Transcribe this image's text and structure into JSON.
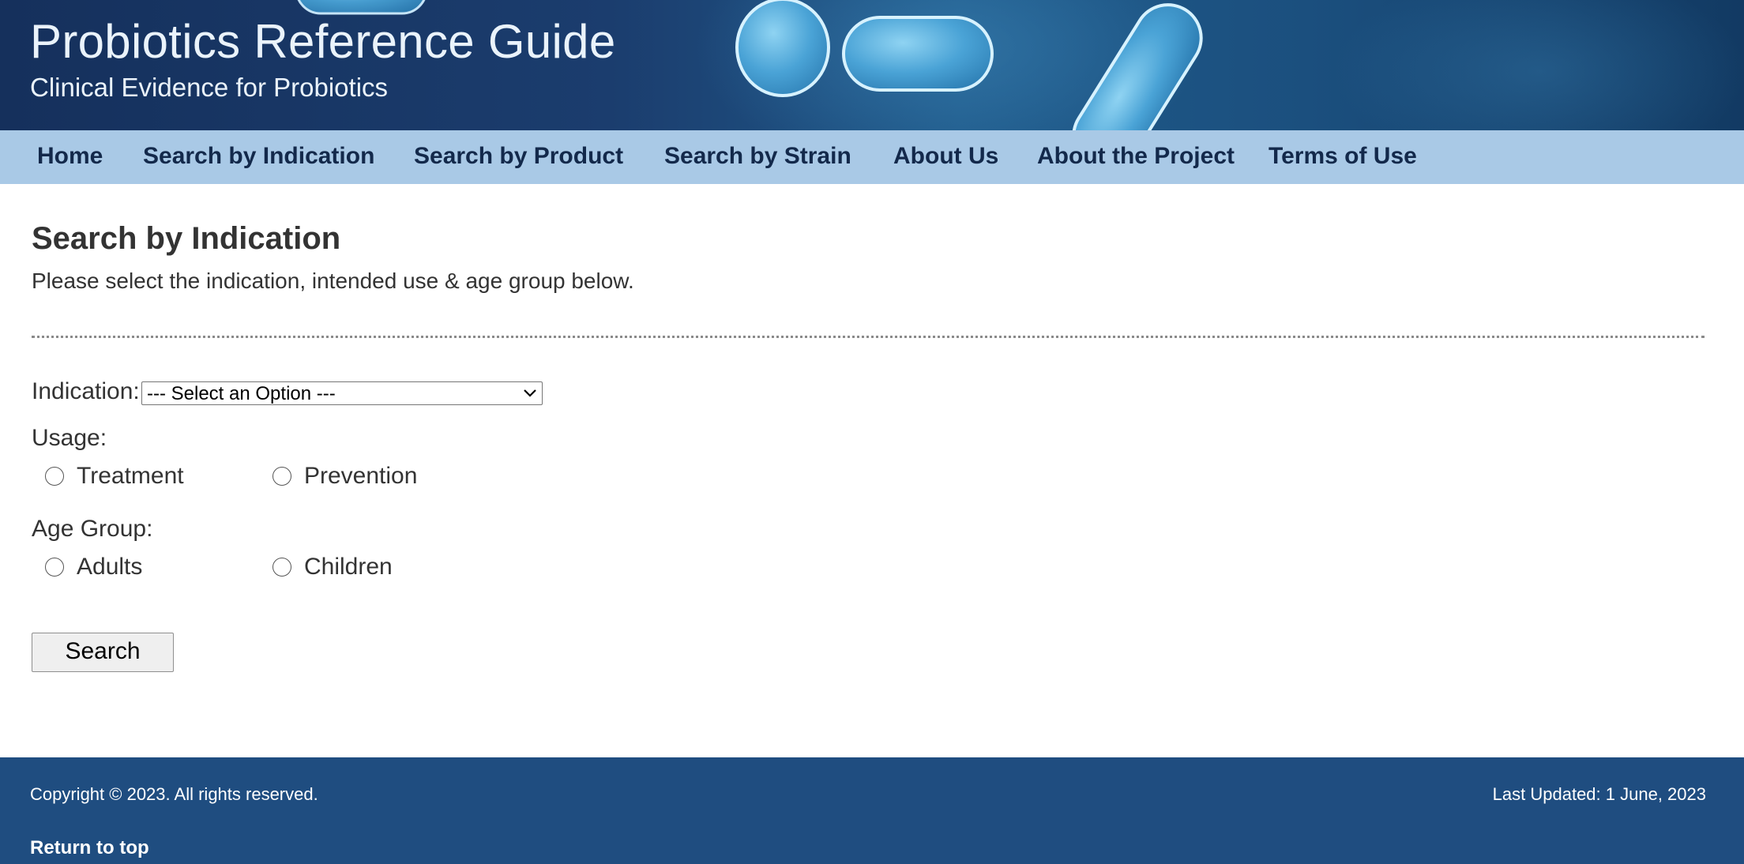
{
  "header": {
    "title": "Probiotics Reference Guide",
    "subtitle": "Clinical Evidence for Probiotics"
  },
  "nav": {
    "items": [
      {
        "label": "Home"
      },
      {
        "label": "Search by Indication"
      },
      {
        "label": "Search by Product"
      },
      {
        "label": "Search by Strain"
      },
      {
        "label": "About Us"
      },
      {
        "label": "About the Project"
      },
      {
        "label": "Terms of Use"
      }
    ]
  },
  "main": {
    "title": "Search by Indication",
    "intro": "Please select the indication, intended use & age group below.",
    "indication": {
      "label": "Indication:",
      "selected": "--- Select an Option ---"
    },
    "usage": {
      "label": "Usage:",
      "options": [
        "Treatment",
        "Prevention"
      ]
    },
    "age_group": {
      "label": "Age Group:",
      "options": [
        "Adults",
        "Children"
      ]
    },
    "search_button": "Search"
  },
  "footer": {
    "copyright": "Copyright © 2023. All rights reserved.",
    "last_updated": "Last Updated: 1 June, 2023",
    "return_to_top": "Return to top"
  },
  "colors": {
    "header_bg": "#1b3d6e",
    "nav_bg": "#a9c9e6",
    "nav_text": "#13294b",
    "footer_bg": "#1f4d80"
  },
  "icons": {
    "select_arrow": "chevron-down-icon"
  }
}
